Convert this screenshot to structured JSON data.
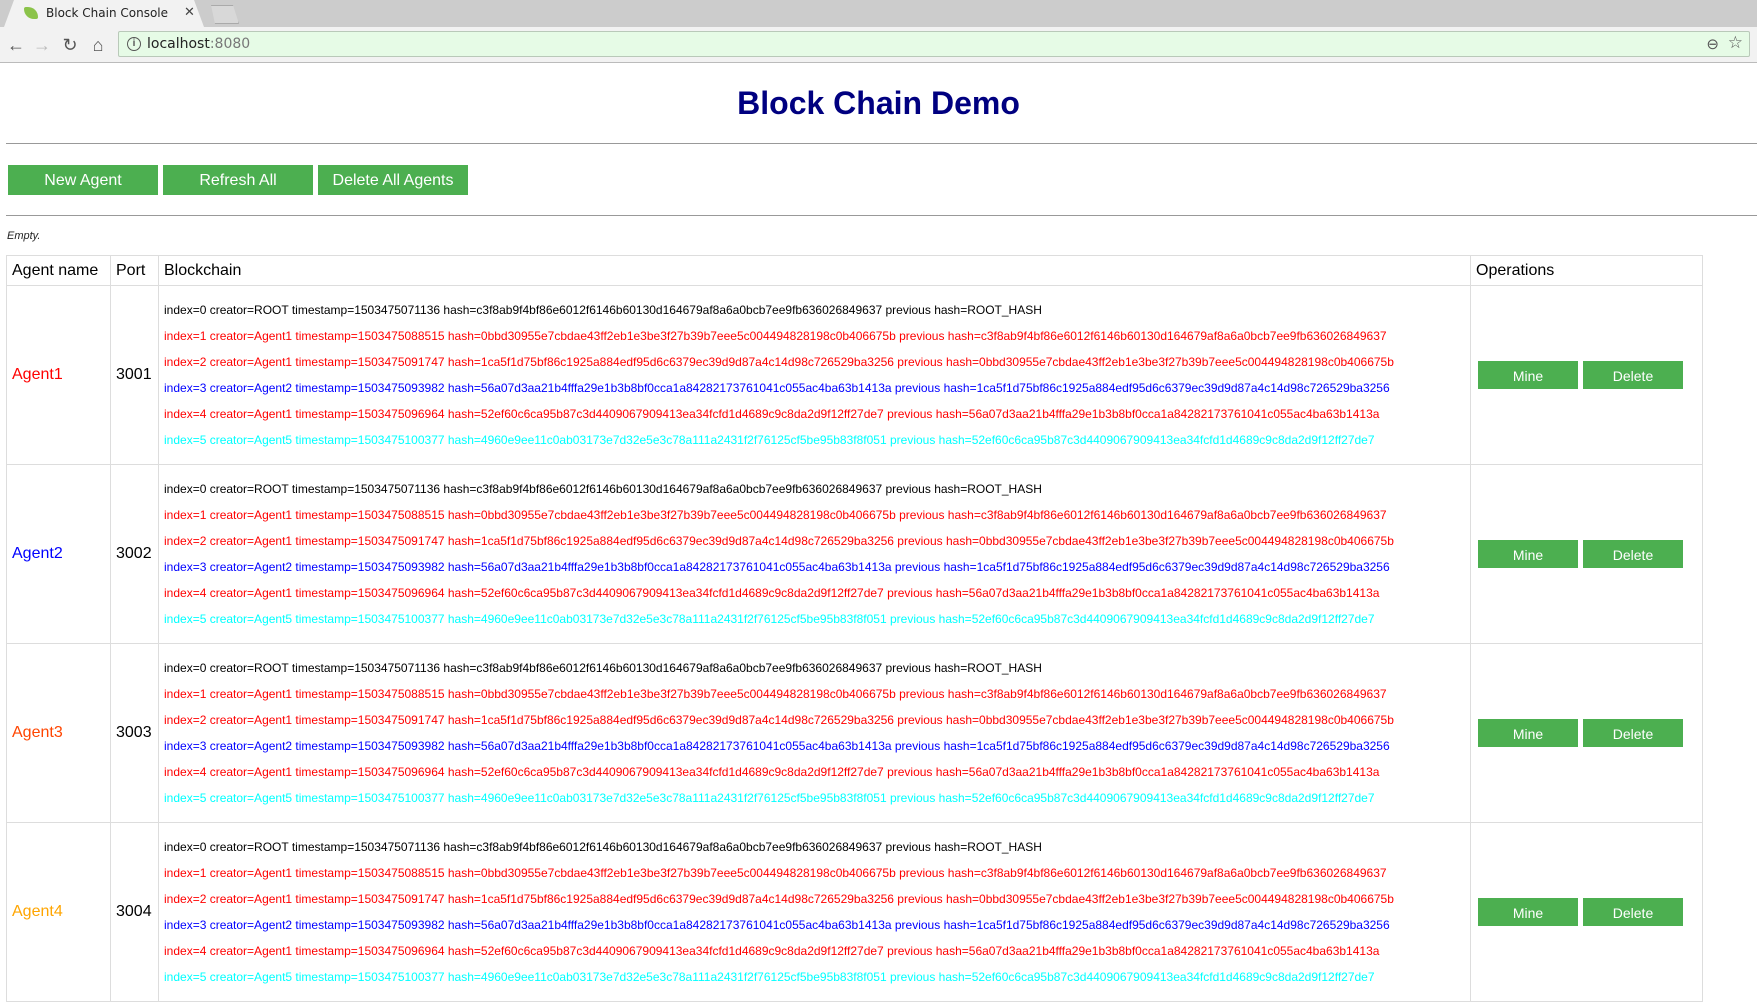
{
  "browser": {
    "tab_title": "Block Chain Console",
    "url_host": "localhost",
    "url_port": ":8080",
    "icons": [
      "back-icon",
      "forward-icon",
      "reload-icon",
      "home-icon",
      "info-icon",
      "zoom-out-icon",
      "star-icon",
      "close-icon"
    ]
  },
  "page": {
    "title": "Block Chain Demo",
    "buttons": {
      "new_agent": "New Agent",
      "refresh_all": "Refresh All",
      "delete_all": "Delete All Agents"
    },
    "status": "Empty."
  },
  "table": {
    "headers": [
      "Agent name",
      "Port",
      "Blockchain",
      "Operations"
    ],
    "ops": {
      "mine": "Mine",
      "delete": "Delete"
    },
    "colors": {
      "ROOT": "#000000",
      "Agent1": "#ff0000",
      "Agent2": "#0000ff",
      "Agent3": "#ff4500",
      "Agent4": "#ffa500",
      "Agent5": "#00ffff"
    },
    "blocks": [
      {
        "creator": "ROOT",
        "text": "index=0 creator=ROOT timestamp=1503475071136 hash=c3f8ab9f4bf86e6012f6146b60130d164679af8a6a0bcb7ee9fb636026849637 previous hash=ROOT_HASH"
      },
      {
        "creator": "Agent1",
        "text": "index=1 creator=Agent1 timestamp=1503475088515 hash=0bbd30955e7cbdae43ff2eb1e3be3f27b39b7eee5c004494828198c0b406675b previous hash=c3f8ab9f4bf86e6012f6146b60130d164679af8a6a0bcb7ee9fb636026849637"
      },
      {
        "creator": "Agent1",
        "text": "index=2 creator=Agent1 timestamp=1503475091747 hash=1ca5f1d75bf86c1925a884edf95d6c6379ec39d9d87a4c14d98c726529ba3256 previous hash=0bbd30955e7cbdae43ff2eb1e3be3f27b39b7eee5c004494828198c0b406675b"
      },
      {
        "creator": "Agent2",
        "text": "index=3 creator=Agent2 timestamp=1503475093982 hash=56a07d3aa21b4fffa29e1b3b8bf0cca1a84282173761041c055ac4ba63b1413a previous hash=1ca5f1d75bf86c1925a884edf95d6c6379ec39d9d87a4c14d98c726529ba3256"
      },
      {
        "creator": "Agent1",
        "text": "index=4 creator=Agent1 timestamp=1503475096964 hash=52ef60c6ca95b87c3d4409067909413ea34fcfd1d4689c9c8da2d9f12ff27de7 previous hash=56a07d3aa21b4fffa29e1b3b8bf0cca1a84282173761041c055ac4ba63b1413a"
      },
      {
        "creator": "Agent5",
        "text": "index=5 creator=Agent5 timestamp=1503475100377 hash=4960e9ee11c0ab03173e7d32e5e3c78a111a2431f2f76125cf5be95b83f8f051 previous hash=52ef60c6ca95b87c3d4409067909413ea34fcfd1d4689c9c8da2d9f12ff27de7"
      }
    ],
    "rows": [
      {
        "name": "Agent1",
        "port": "3001"
      },
      {
        "name": "Agent2",
        "port": "3002"
      },
      {
        "name": "Agent3",
        "port": "3003"
      },
      {
        "name": "Agent4",
        "port": "3004"
      }
    ]
  },
  "theme": {
    "button_green": "#4caf50",
    "title_navy": "#000080"
  }
}
